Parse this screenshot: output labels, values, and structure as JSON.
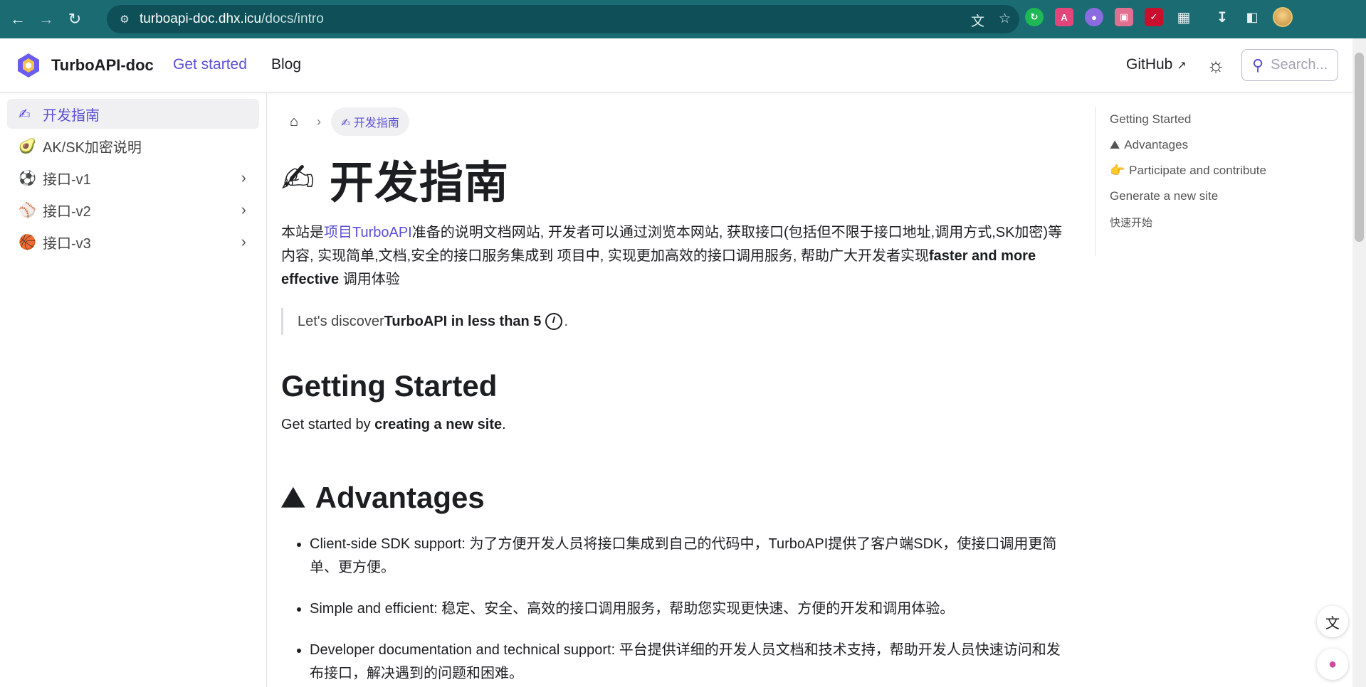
{
  "browser": {
    "url_host": "turboapi-doc.dhx.icu",
    "url_path": "/docs/intro",
    "back_icon": "arrow-left-icon",
    "forward_icon": "arrow-right-icon",
    "reload_icon": "reload-icon"
  },
  "navbar": {
    "brand": "TurboAPI-doc",
    "links": [
      "Get started",
      "Blog"
    ],
    "github": "GitHub",
    "search_placeholder": "Search..."
  },
  "sidebar": {
    "items": [
      {
        "emoji": "✍",
        "label": "开发指南"
      },
      {
        "emoji": "🥑",
        "label": "AK/SK加密说明"
      },
      {
        "emoji": "⚽",
        "label": "接口-v1"
      },
      {
        "emoji": "⚾",
        "label": "接口-v2"
      },
      {
        "emoji": "🏀",
        "label": "接口-v3"
      }
    ]
  },
  "breadcrumb": {
    "current": "开发指南"
  },
  "page": {
    "title": "开发指南",
    "intro_pre": "本站是",
    "intro_link": "项目TurboAPI",
    "intro_mid": "准备的说明文档网站, 开发者可以通过浏览本网站, 获取接口(包括但不限于接口地址,调用方式,SK加密)等内容, 实现简单,文档,安全的接口服务集成到 项目中, 实现更加高效的接口调用服务, 帮助广大开发者实现",
    "intro_bold": "faster and more effective",
    "intro_post": " 调用体验",
    "quote_pre": "Let's discover ",
    "quote_bold": "TurboAPI in less than 5",
    "quote_post": ".",
    "h2_getting_started": "Getting Started",
    "gs_pre": "Get started by ",
    "gs_bold": "creating a new site",
    "gs_post": ".",
    "h2_advantages": "Advantages",
    "advantages": [
      {
        "term": "Client-side SDK support:",
        "text": " 为了方便开发人员将接口集成到自己的代码中，TurboAPI提供了客户端SDK，使接口调用更简单、更方便。"
      },
      {
        "term": "Simple and efficient:",
        "text": " 稳定、安全、高效的接口调用服务，帮助您实现更快速、方便的开发和调用体验。"
      },
      {
        "term": "Developer documentation and technical support:",
        "text": " 平台提供详细的开发人员文档和技术支持，帮助开发人员快速访问和发布接口，解决遇到的问题和困难。"
      }
    ]
  },
  "toc": {
    "items": [
      {
        "icon": "",
        "label": "Getting Started"
      },
      {
        "icon": "⛰",
        "label": "Advantages"
      },
      {
        "icon": "👉",
        "label": "Participate and contribute"
      },
      {
        "icon": "",
        "label": "Generate a new site"
      },
      {
        "icon": "",
        "label": "快速开始"
      }
    ]
  },
  "colors": {
    "accent": "#5a4fd6",
    "chrome": "#1b6b73"
  }
}
